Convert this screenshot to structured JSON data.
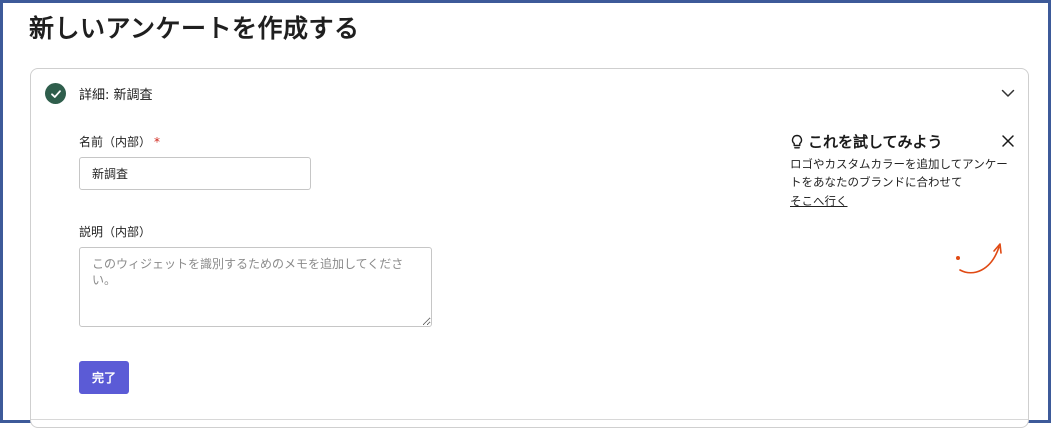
{
  "page": {
    "title": "新しいアンケートを作成する"
  },
  "section": {
    "title": "詳細: 新調査",
    "fields": {
      "name": {
        "label": "名前（内部）",
        "required_mark": "*",
        "value": "新調査"
      },
      "description": {
        "label": "説明（内部）",
        "placeholder": "このウィジェットを識別するためのメモを追加してください。"
      }
    },
    "done_label": "完了"
  },
  "tip": {
    "title": "これを試してみよう",
    "body": "ロゴやカスタムカラーを追加してアンケートをあなたのブランドに合わせて",
    "link": "そこへ行く"
  },
  "colors": {
    "accent": "#5b5bd6",
    "check": "#2f5e4c",
    "required": "#d0271c",
    "arrow": "#e04a14",
    "frame": "#3d5a99"
  }
}
